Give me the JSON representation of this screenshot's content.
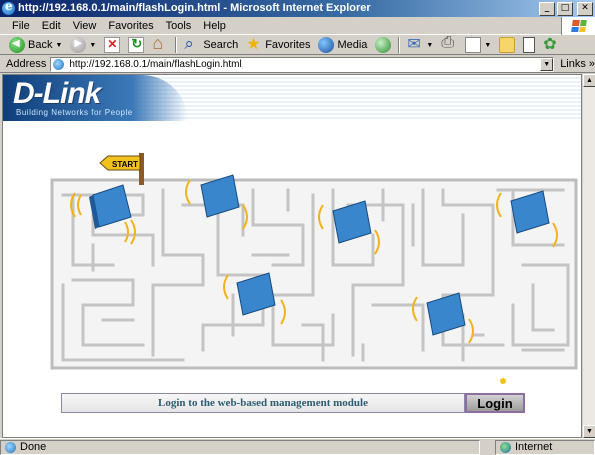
{
  "window": {
    "title": "http://192.168.0.1/main/flashLogin.html - Microsoft Internet Explorer",
    "controls": {
      "minimize": "_",
      "maximize": "□",
      "close": "✕"
    }
  },
  "menu": {
    "items": [
      {
        "label": "File"
      },
      {
        "label": "Edit"
      },
      {
        "label": "View"
      },
      {
        "label": "Favorites"
      },
      {
        "label": "Tools"
      },
      {
        "label": "Help"
      }
    ]
  },
  "toolbar": {
    "back_label": "Back",
    "search_label": "Search",
    "favorites_label": "Favorites",
    "media_label": "Media",
    "icons": [
      "back-icon",
      "forward-icon",
      "stop-icon",
      "refresh-icon",
      "home-icon",
      "search-icon",
      "favorites-icon",
      "media-icon",
      "history-icon",
      "mail-icon",
      "print-icon",
      "edit-icon",
      "folder-icon",
      "messenger-icon",
      "msn-icon"
    ]
  },
  "address": {
    "label": "Address",
    "url": "http://192.168.0.1/main/flashLogin.html",
    "links_label": "Links"
  },
  "page": {
    "logo": "D-Link",
    "tagline": "Building Networks for People",
    "start_sign": "START",
    "login_prompt": "Login to the web-based management module",
    "login_button": "Login",
    "colors": {
      "maze_wall": "#c8c8c8",
      "router_blue": "#3a86cc",
      "signal": "#f2b21c",
      "prompt_text": "#2c5c70"
    }
  },
  "status": {
    "text": "Done",
    "zone": "Internet"
  }
}
